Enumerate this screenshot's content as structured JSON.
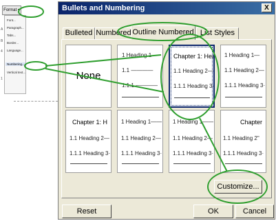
{
  "format_menu": {
    "button_label": "Format ▾",
    "items": [
      "Font...",
      "Paragraph...",
      "Tabs...",
      "Border...",
      "Language...",
      "",
      "Numbering...",
      "Vertical text..."
    ],
    "side_marks": [
      "A",
      "B",
      "4",
      "1"
    ]
  },
  "dialog": {
    "title": "Bullets and Numbering",
    "close_label": "X",
    "tabs": [
      "Bulleted",
      "Numbered",
      "Outline Numbered",
      "List Styles"
    ],
    "active_tab": "Outline Numbered",
    "tiles": [
      {
        "kind": "none",
        "label": "None"
      },
      {
        "kind": "list",
        "levels": [
          "1  Heading 1—",
          "1.1 ————",
          "1.1.1 ————"
        ]
      },
      {
        "kind": "list",
        "selected": true,
        "levels": [
          "Chapter 1: Hea",
          "1.1 Heading 2—",
          "1.1.1 Heading 3·"
        ]
      },
      {
        "kind": "list",
        "levels": [
          "1  Heading 1—",
          "1.1 Heading 2—",
          "1.1.1 Heading 3·"
        ]
      },
      {
        "kind": "list",
        "levels": [
          "Chapter 1: H",
          "1.1 Heading 2—",
          "1.1.1 Heading 3·"
        ]
      },
      {
        "kind": "list",
        "levels": [
          "1  Heading 1——",
          "1.1 Heading 2—",
          "1.1.1 Heading 3·"
        ]
      },
      {
        "kind": "list",
        "levels": [
          "1  Heading 1——",
          "1.1 Heading 2—",
          "1.1.1 Heading 3·"
        ]
      },
      {
        "kind": "list",
        "levels": [
          "Chapter",
          "1.1 Heading 2\"",
          "1.1.1 Heading 3·"
        ]
      }
    ],
    "buttons": {
      "customize": "Customize...",
      "reset": "Reset",
      "ok": "OK",
      "cancel": "Cancel"
    }
  },
  "colors": {
    "titlebar": "#0a246a",
    "dialog_face": "#ece9d8",
    "annotation": "#2e9e2e"
  }
}
